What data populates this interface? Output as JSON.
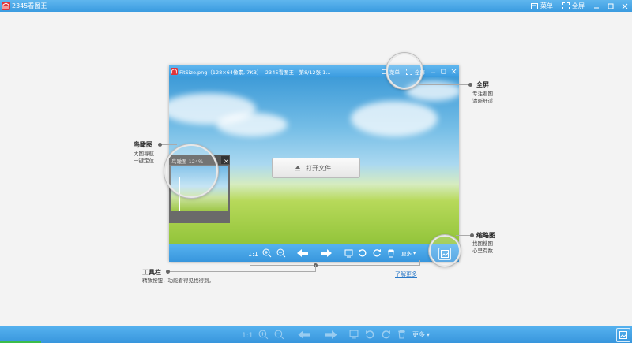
{
  "app": {
    "title": "2345看图王",
    "brand_color": "#e0343a",
    "bar_color": "#3a9be0",
    "menu_label": "菜单",
    "fullscreen_label": "全屏",
    "icons": [
      "app-logo-icon",
      "menu-icon",
      "fullscreen-icon",
      "minimize-icon",
      "maximize-icon",
      "close-icon"
    ]
  },
  "demo_window": {
    "title": "FitSize.png（128×64像素, 7KB）- 2345看图王 - 第8/12张 1...",
    "menu_label": "菜单",
    "fullscreen_label": "全屏",
    "open_file_label": "打开文件...",
    "more_label": "更多"
  },
  "bird_view": {
    "title": "鸟瞰图 124%"
  },
  "annotations": {
    "fullscreen": {
      "title": "全屏",
      "lines": [
        "专注看图",
        "清晰舒适"
      ]
    },
    "bird": {
      "title": "鸟瞰图",
      "lines": [
        "大图导航",
        "一键定位"
      ]
    },
    "thumbnail": {
      "title": "缩略图",
      "lines": [
        "找图搜图",
        "心里有数"
      ]
    },
    "toolbar": {
      "title": "工具栏",
      "lines": [
        "精致按钮，功能看得见找得到。"
      ]
    }
  },
  "learn_more": "了解更多",
  "bottom_toolbar": {
    "more_label": "更多",
    "buttons": [
      "actual-size-icon",
      "zoom-in-icon",
      "zoom-out-icon",
      "previous-icon",
      "next-icon",
      "fit-icon",
      "rotate-left-icon",
      "rotate-right-icon",
      "delete-icon"
    ]
  }
}
